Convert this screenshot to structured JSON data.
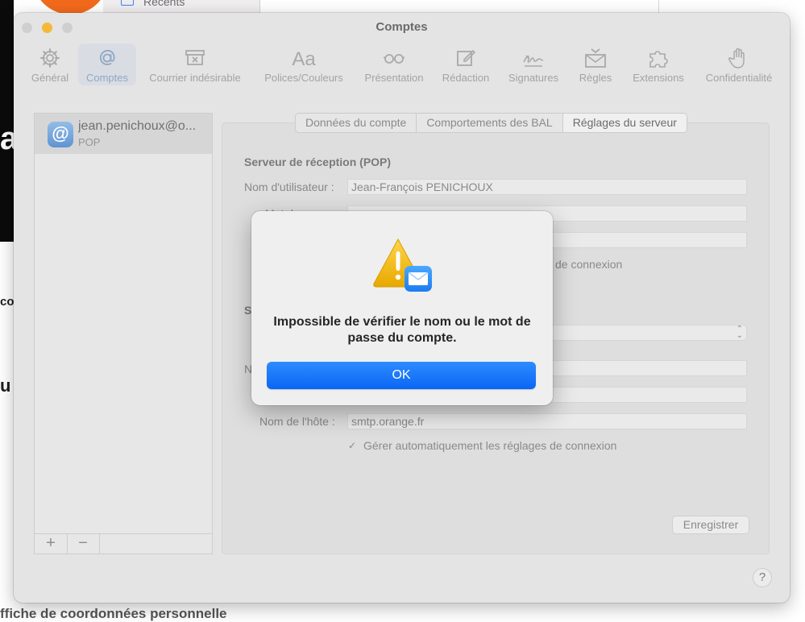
{
  "background": {
    "sidebar_label": "Récents",
    "big_letter": "a",
    "left_text_1": "co",
    "left_text_2": "u",
    "bottom_text": "ffiche de coordonnées personnelle"
  },
  "window": {
    "title": "Comptes"
  },
  "toolbar": {
    "items": [
      {
        "label": "Général",
        "icon": "gear-icon"
      },
      {
        "label": "Comptes",
        "icon": "at-icon"
      },
      {
        "label": "Courrier indésirable",
        "icon": "junk-mail-icon"
      },
      {
        "label": "Polices/Couleurs",
        "icon": "font-icon"
      },
      {
        "label": "Présentation",
        "icon": "glasses-icon"
      },
      {
        "label": "Rédaction",
        "icon": "compose-icon"
      },
      {
        "label": "Signatures",
        "icon": "signature-icon"
      },
      {
        "label": "Règles",
        "icon": "rules-icon"
      },
      {
        "label": "Extensions",
        "icon": "puzzle-icon"
      },
      {
        "label": "Confidentialité",
        "icon": "hand-icon"
      }
    ],
    "font_icon_text": "Aa"
  },
  "accounts": {
    "selected_name": "jean.penichoux@o...",
    "selected_type": "POP",
    "add_label": "+",
    "remove_label": "−"
  },
  "tabs": [
    {
      "label": "Données du compte"
    },
    {
      "label": "Comportements des BAL"
    },
    {
      "label": "Réglages du serveur"
    }
  ],
  "incoming": {
    "section_title": "Serveur de réception (POP)",
    "username_label": "Nom d'utilisateur :",
    "username_value": "Jean-François PENICHOUX",
    "password_label_partial": "Mot de",
    "manage_label_partial": "de connexion"
  },
  "outgoing": {
    "section_title_partial": "S",
    "name_label_partial": "N",
    "host_label": "Nom de l'hôte :",
    "host_value": "smtp.orange.fr",
    "manage_label": "Gérer automatiquement les réglages de connexion",
    "check_mark": "✓"
  },
  "buttons": {
    "save": "Enregistrer",
    "help": "?"
  },
  "alert": {
    "message": "Impossible de vérifier le nom ou le mot de passe du compte.",
    "ok_label": "OK",
    "icon": "warning-mail-icon"
  },
  "colors": {
    "accent": "#0a66f5",
    "warning": "#f5c31c",
    "traffic_minimize": "#f4b83a"
  }
}
